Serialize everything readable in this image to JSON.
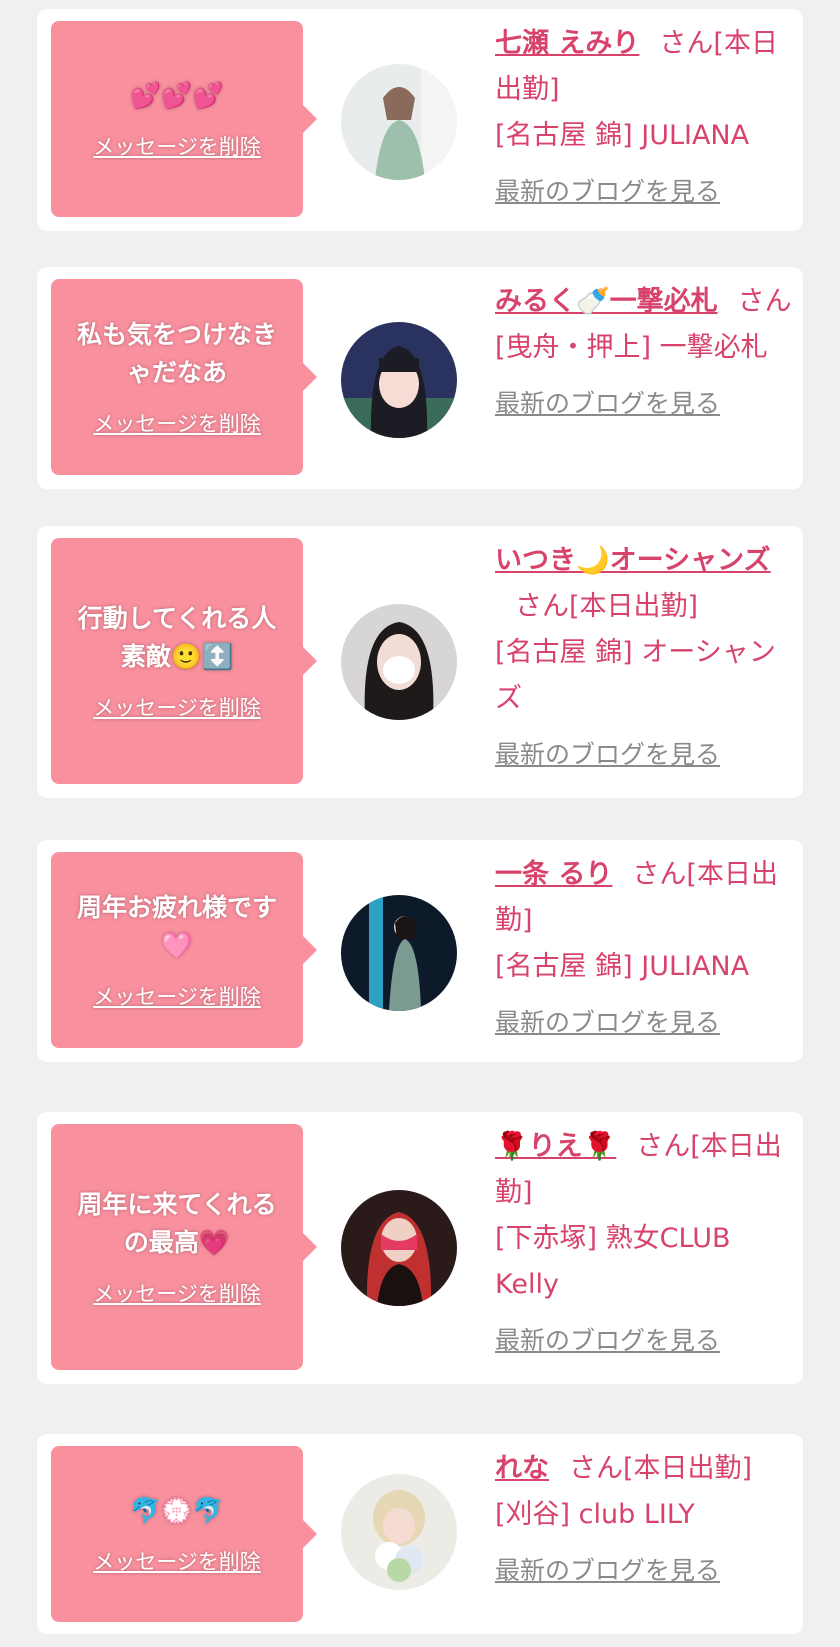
{
  "delete_label": "メッセージを削除",
  "blog_label": "最新のブログを見る",
  "colors": {
    "bubble": "#f8909e",
    "accent_text": "#d8436c",
    "blog_link": "#8a8a8a",
    "page_bg": "#f0f0f0"
  },
  "cards": [
    {
      "message": "💕💕💕",
      "name": "七瀬 えみり",
      "suffix": "さん[本日出勤]",
      "shop": "[名古屋 錦] JULIANA"
    },
    {
      "message": "私も気をつけなきゃだなあ",
      "name": "みるく🍼一撃必札",
      "suffix": "さん",
      "shop": "[曳舟・押上] 一撃必札"
    },
    {
      "message": "行動してくれる人素敵🙂↕️",
      "name": "いつき🌙オーシャンズ",
      "suffix": "さん[本日出勤]",
      "shop": "[名古屋 錦] オーシャンズ"
    },
    {
      "message": "周年お疲れ様です🩷",
      "name": "一条 るり",
      "suffix": "さん[本日出勤]",
      "shop": "[名古屋 錦] JULIANA"
    },
    {
      "message": "周年に来てくれるの最高💗",
      "name": "🌹りえ🌹",
      "suffix": "さん[本日出勤]",
      "shop": "[下赤塚] 熟女CLUB Kelly"
    },
    {
      "message": "🐬💮🐬",
      "name": "れな",
      "suffix": "さん[本日出勤]",
      "shop": "[刈谷] club LILY"
    }
  ]
}
